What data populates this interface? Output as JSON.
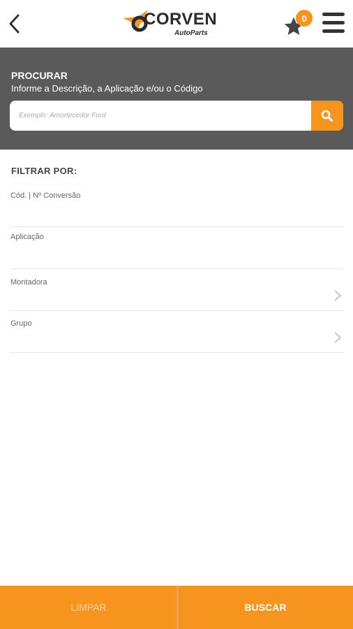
{
  "header": {
    "logo_text": "CORVEN",
    "logo_subtext": "AutoParts",
    "favorites_count": "0",
    "accent_color": "#f7941d"
  },
  "search": {
    "title": "PROCURAR",
    "subtitle": "Informe a Descrição, a Aplicação e/ou o Código",
    "placeholder": "Exemplo: Amortecedor Ford",
    "value": ""
  },
  "filters": {
    "title": "FILTRAR POR:",
    "items": [
      {
        "label": "Cód. | Nº Conversão",
        "has_chevron": false
      },
      {
        "label": "Aplicação",
        "has_chevron": false
      },
      {
        "label": "Montadora",
        "has_chevron": true
      },
      {
        "label": "Grupo",
        "has_chevron": true
      }
    ]
  },
  "actions": {
    "clear_label": "LIMPAR",
    "search_label": "BUSCAR"
  }
}
